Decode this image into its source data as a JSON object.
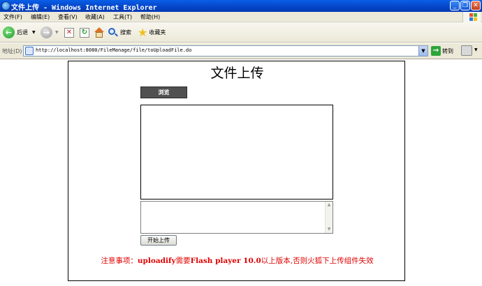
{
  "window": {
    "title": "文件上传 - Windows Internet Explorer",
    "minimize": "_",
    "restore": "❐",
    "close": "✕"
  },
  "menu": {
    "items": [
      "文件(F)",
      "编辑(E)",
      "查看(V)",
      "收藏(A)",
      "工具(T)",
      "帮助(H)"
    ]
  },
  "toolbar": {
    "back_label": "后退",
    "search_label": "搜索",
    "favorites_label": "收藏夹"
  },
  "address": {
    "label": "地址(D)",
    "url": "http://localhost:8080/FileManage/file/toUploadFile.do",
    "go_label": "转到"
  },
  "page": {
    "title": "文件上传",
    "browse_label": "浏览",
    "start_upload_label": "开始上传",
    "notice_prefix": "注意事项：",
    "notice_bold1": "uploadify",
    "notice_mid1": "需要",
    "notice_bold2": "Flash player 10.0",
    "notice_rest": "以上版本,否则火狐下上传组件失效"
  },
  "colors": {
    "titlebar": "#0a5fe8",
    "notice": "#e00000",
    "browse_button": "#505050"
  }
}
